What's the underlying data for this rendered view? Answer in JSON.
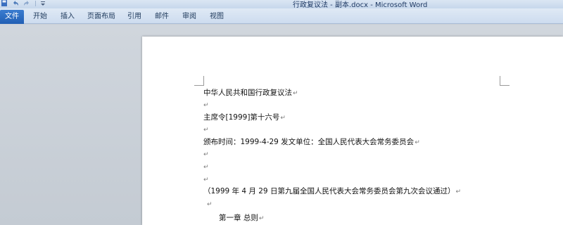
{
  "window": {
    "title": "行政复议法 - 副本.docx - Microsoft Word"
  },
  "quick_access": {
    "save_icon": "save-icon",
    "undo_icon": "undo-icon",
    "redo_icon": "redo-icon"
  },
  "ribbon": {
    "file_tab": "文件",
    "tabs": [
      "开始",
      "插入",
      "页面布局",
      "引用",
      "邮件",
      "审阅",
      "视图"
    ]
  },
  "document": {
    "paragraph_mark": "↵",
    "lines": [
      "中华人民共和国行政复议法",
      "主席令[1999]第十六号",
      "颁布时间：1999-4-29 发文单位：全国人民代表大会常务委员会",
      "（1999 年 4 月 29 日第九届全国人民代表大会常务委员会第九次会议通过）",
      "第一章 总则"
    ]
  },
  "colors": {
    "file_tab": "#215fb4",
    "workspace": "#c9cfd6",
    "page": "#ffffff"
  }
}
